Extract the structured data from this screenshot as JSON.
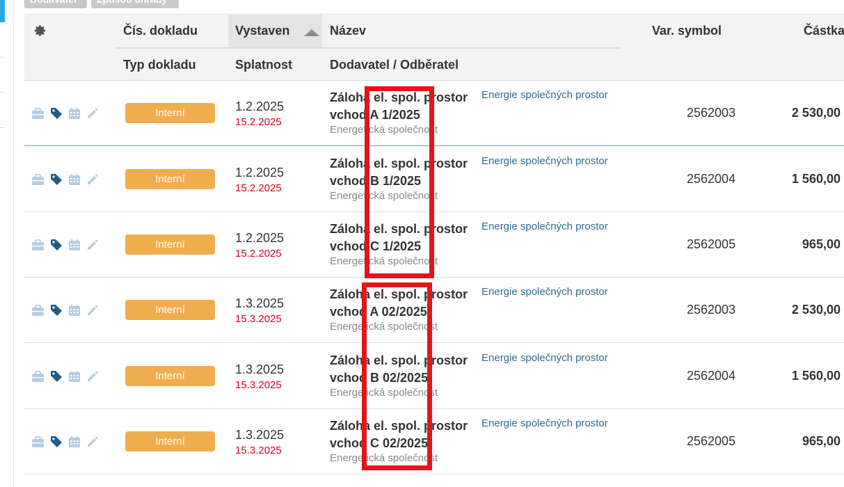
{
  "filters": [
    {
      "label": "Dodavatel"
    },
    {
      "label": "Způsob úhrady"
    }
  ],
  "header": {
    "doc_number": "Čís. dokladu",
    "issued": "Vystaven",
    "name": "Název",
    "var_symbol": "Var. symbol",
    "amount": "Částka",
    "doc_type": "Typ dokladu",
    "due": "Splatnost",
    "party": "Dodavatel / Odběratel"
  },
  "rows": [
    {
      "type": "Interní",
      "issued": "1.2.2025",
      "due": "15.2.2025",
      "name": "Záloha el. spol. prostor vchod A 1/2025",
      "supplier": "Energetická společnost",
      "link": "Energie společných prostor",
      "var_symbol": "2562003",
      "amount": "2 530,00"
    },
    {
      "type": "Interní",
      "issued": "1.2.2025",
      "due": "15.2.2025",
      "name": "Záloha el. spol. prostor vchod B 1/2025",
      "supplier": "Energetická společnost",
      "link": "Energie společných prostor",
      "var_symbol": "2562004",
      "amount": "1 560,00"
    },
    {
      "type": "Interní",
      "issued": "1.2.2025",
      "due": "15.2.2025",
      "name": "Záloha el. spol. prostor vchod C 1/2025",
      "supplier": "Energetická společnost",
      "link": "Energie společných prostor",
      "var_symbol": "2562005",
      "amount": "965,00"
    },
    {
      "type": "Interní",
      "issued": "1.3.2025",
      "due": "15.3.2025",
      "name": "Záloha el. spol. prostor vchod A 02/2025",
      "supplier": "Energetická společnost",
      "link": "Energie společných prostor",
      "var_symbol": "2562003",
      "amount": "2 530,00"
    },
    {
      "type": "Interní",
      "issued": "1.3.2025",
      "due": "15.3.2025",
      "name": "Záloha el. spol. prostor vchod B 02/2025",
      "supplier": "Energetická společnost",
      "link": "Energie společných prostor",
      "var_symbol": "2562004",
      "amount": "1 560,00"
    },
    {
      "type": "Interní",
      "issued": "1.3.2025",
      "due": "15.3.2025",
      "name": "Záloha el. spol. prostor vchod C 02/2025",
      "supplier": "Energetická společnost",
      "link": "Energie společných prostor",
      "var_symbol": "2562005",
      "amount": "965,00"
    }
  ],
  "icons": [
    "briefcase-icon",
    "tag-icon",
    "calendar-icon",
    "pencil-icon",
    "gear-icon",
    "sort-asc-icon"
  ],
  "colors": {
    "badge": "#f0ad4e",
    "due_date": "#d0021b",
    "link": "#2f6a8f",
    "highlight_box": "#e0161b",
    "tag_icon": "#1f5c86",
    "muted_icon": "#b5cde0"
  }
}
